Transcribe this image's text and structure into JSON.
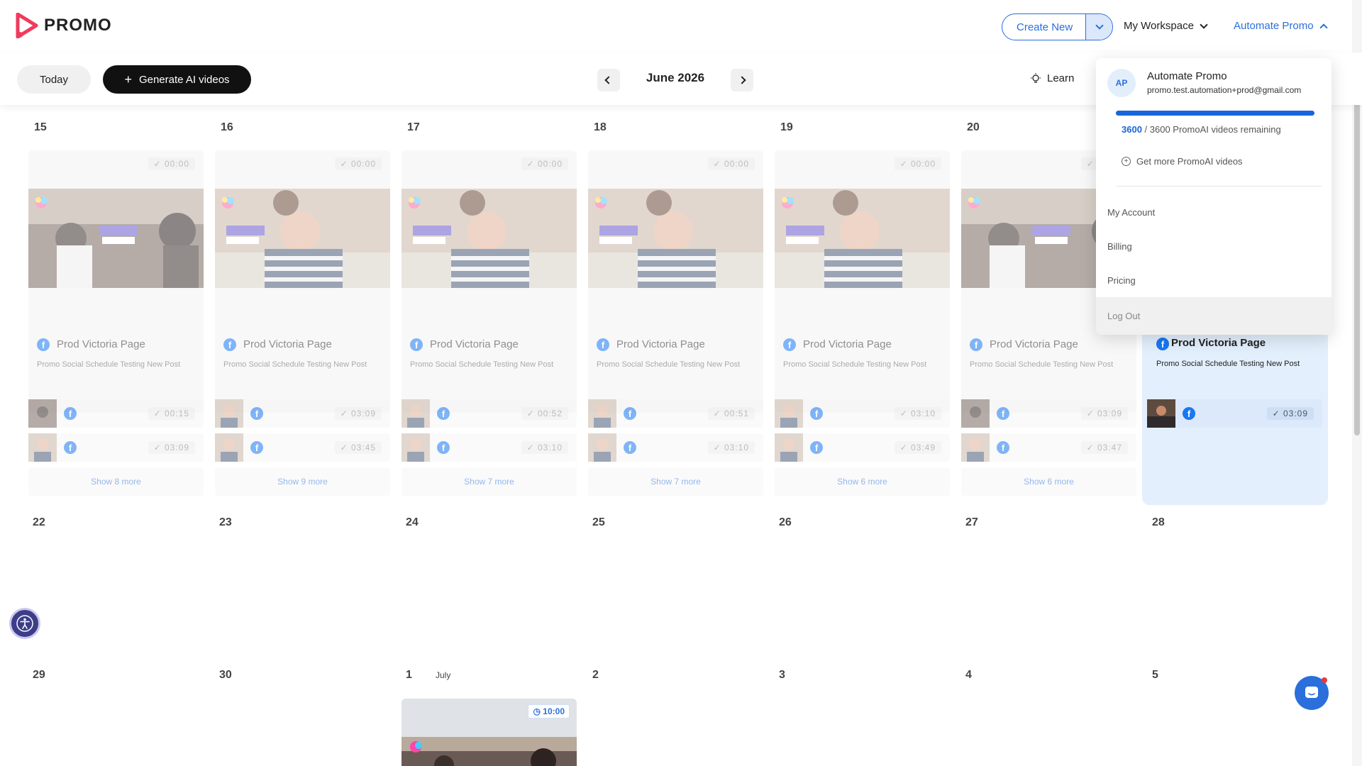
{
  "header": {
    "logo_text": "PROMO",
    "create_new": "Create New",
    "workspace": "My Workspace",
    "account_menu": "Automate Promo"
  },
  "toolbar": {
    "today": "Today",
    "generate": "Generate AI videos",
    "month": "June 2026",
    "learn": "Learn"
  },
  "week1": {
    "days": [
      {
        "num": "15",
        "duration": "00:00",
        "page": "Prod Victoria Page",
        "desc": "Promo Social Schedule Testing New Post",
        "subs": [
          "00:15",
          "03:09"
        ],
        "more": "Show 8 more"
      },
      {
        "num": "16",
        "duration": "00:00",
        "page": "Prod Victoria Page",
        "desc": "Promo Social Schedule Testing New Post",
        "subs": [
          "03:09",
          "03:45"
        ],
        "more": "Show 9 more"
      },
      {
        "num": "17",
        "duration": "00:00",
        "page": "Prod Victoria Page",
        "desc": "Promo Social Schedule Testing New Post",
        "subs": [
          "00:52",
          "03:10"
        ],
        "more": "Show 7 more"
      },
      {
        "num": "18",
        "duration": "00:00",
        "page": "Prod Victoria Page",
        "desc": "Promo Social Schedule Testing New Post",
        "subs": [
          "00:51",
          "03:10"
        ],
        "more": "Show 7 more"
      },
      {
        "num": "19",
        "duration": "00:00",
        "page": "Prod Victoria Page",
        "desc": "Promo Social Schedule Testing New Post",
        "subs": [
          "03:10",
          "03:49"
        ],
        "more": "Show 6 more"
      },
      {
        "num": "20",
        "duration": "00:00",
        "page": "Prod Victoria Page",
        "desc": "Promo Social Schedule Testing New Post",
        "subs": [
          "03:09",
          "03:47"
        ],
        "more": "Show 6 more"
      }
    ],
    "today": {
      "page": "Prod Victoria Page",
      "desc": "Promo Social Schedule Testing New Post",
      "sub": "03:09"
    }
  },
  "week2": [
    "22",
    "23",
    "24",
    "25",
    "26",
    "27",
    "28"
  ],
  "week3": [
    "29",
    "30",
    "1",
    "2",
    "3",
    "4",
    "5"
  ],
  "july_label": "July",
  "july_event_time": "10:00",
  "dropdown": {
    "avatar": "AP",
    "name": "Automate Promo",
    "email": "promo.test.automation+prod@gmail.com",
    "remaining_count": "3600",
    "remaining_text": " / 3600 PromoAI videos remaining",
    "progress_fraction": 1.0,
    "get_more": "Get more PromoAI videos",
    "items": [
      "My Account",
      "Billing",
      "Pricing",
      "Log Out"
    ]
  },
  "icons": {
    "facebook": "facebook-icon",
    "lightbulb": "lightbulb-icon",
    "accessibility": "accessibility-icon",
    "chat": "chat-icon"
  },
  "colors": {
    "accent": "#2a6fdb",
    "progress": "#1666dd",
    "today_column": "#e3effc"
  }
}
